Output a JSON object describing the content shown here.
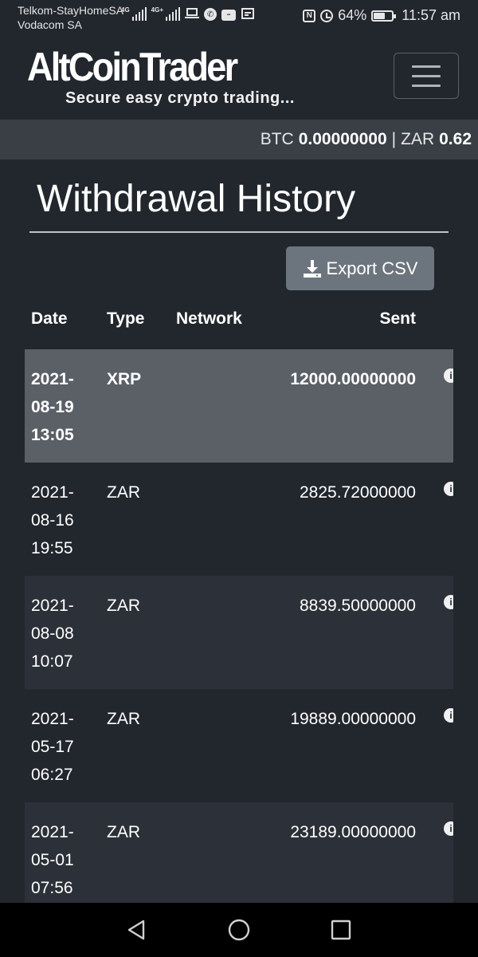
{
  "status_bar": {
    "carrier_1": "Telkom-StayHomeSA",
    "carrier_2": "Vodacom SA",
    "signal_1_tag": "4G",
    "signal_2_tag": "4G+",
    "battery_percent": "64%",
    "battery_level": 0.64,
    "time": "11:57 am",
    "icons": [
      "signal-icon",
      "laptop-icon",
      "phone-icon",
      "huawei-icon",
      "calendar-icon",
      "nfc-icon",
      "alarm-icon",
      "battery-icon"
    ]
  },
  "header": {
    "logo_text": "AltCoinTrader",
    "tagline": "Secure easy crypto trading...",
    "menu_icon": "hamburger-menu-icon"
  },
  "balance": {
    "btc_label": "BTC",
    "btc_value": "0.00000000",
    "separator": "|",
    "zar_label": "ZAR",
    "zar_value": "0.62"
  },
  "page": {
    "title": "Withdrawal History",
    "export_label": "Export CSV",
    "export_icon": "download-icon"
  },
  "table": {
    "headers": {
      "date": "Date",
      "type": "Type",
      "network": "Network",
      "sent": "Sent"
    },
    "rows": [
      {
        "date": "2021-\n08-19\n13:05",
        "type": "XRP",
        "network": "",
        "sent": "12000.00000000"
      },
      {
        "date": "2021-\n08-16\n19:55",
        "type": "ZAR",
        "network": "",
        "sent": "2825.72000000"
      },
      {
        "date": "2021-\n08-08\n10:07",
        "type": "ZAR",
        "network": "",
        "sent": "8839.50000000"
      },
      {
        "date": "2021-\n05-17\n06:27",
        "type": "ZAR",
        "network": "",
        "sent": "19889.00000000"
      },
      {
        "date": "2021-\n05-01\n07:56",
        "type": "ZAR",
        "network": "",
        "sent": "23189.00000000"
      }
    ]
  },
  "colors": {
    "background": "#22262d",
    "balance_bar": "#3a3f46",
    "highlight_row": "#5b6067",
    "button": "#6c757d"
  }
}
